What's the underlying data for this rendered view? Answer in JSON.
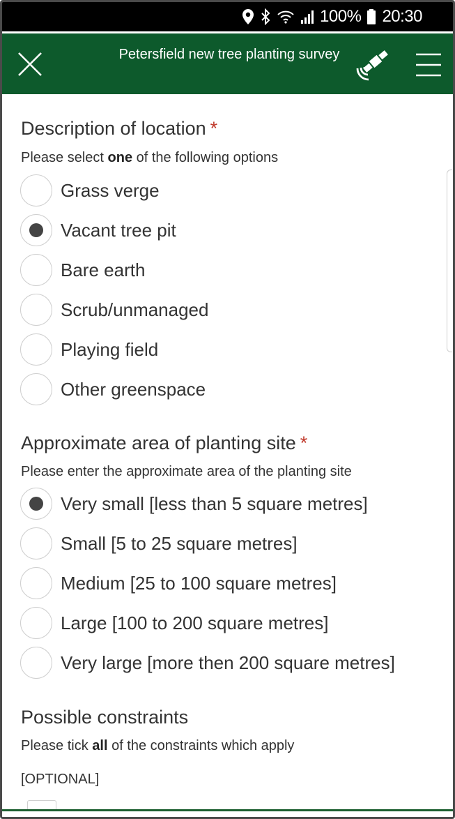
{
  "status_bar": {
    "battery": "100%",
    "time": "20:30",
    "icons": [
      "location-icon",
      "bluetooth-icon",
      "wifi-icon",
      "signal-icon",
      "battery-icon"
    ]
  },
  "header": {
    "title": "Petersfield new tree planting survey",
    "background": "#0d5a2c"
  },
  "questions": [
    {
      "title": "Description of location",
      "required_mark": "*",
      "hint_before": "Please select ",
      "hint_bold": "one",
      "hint_after": " of the following options",
      "options": [
        {
          "label": "Grass verge",
          "selected": false
        },
        {
          "label": "Vacant tree pit",
          "selected": true
        },
        {
          "label": "Bare earth",
          "selected": false
        },
        {
          "label": "Scrub/unmanaged",
          "selected": false
        },
        {
          "label": "Playing field",
          "selected": false
        },
        {
          "label": "Other greenspace",
          "selected": false
        }
      ]
    },
    {
      "title": "Approximate area of planting site",
      "required_mark": "*",
      "hint": "Please enter the approximate area of the planting site",
      "options": [
        {
          "label": "Very small [less than 5 square metres]",
          "selected": true
        },
        {
          "label": "Small [5 to 25 square metres]",
          "selected": false
        },
        {
          "label": "Medium [25 to 100 square metres]",
          "selected": false
        },
        {
          "label": "Large [100 to 200 square metres]",
          "selected": false
        },
        {
          "label": "Very large [more then 200 square metres]",
          "selected": false
        }
      ]
    },
    {
      "title": "Possible constraints",
      "hint_before": "Please tick ",
      "hint_bold": "all",
      "hint_after": " of the constraints which apply",
      "optional": "[OPTIONAL]"
    }
  ]
}
